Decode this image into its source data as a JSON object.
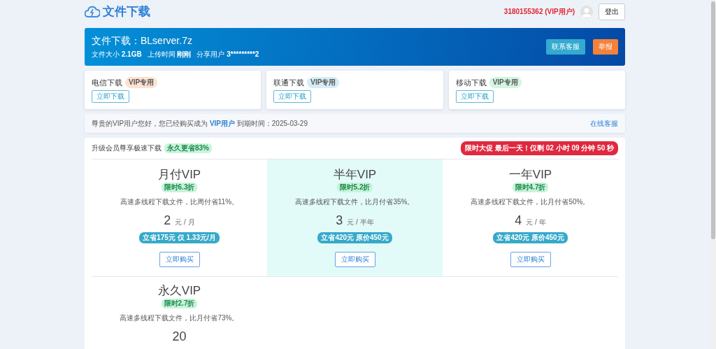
{
  "header": {
    "logo_text": "文件下载",
    "user": "3180155362 (VIP用户)",
    "logout": "登出"
  },
  "banner": {
    "title": "文件下载：BLserver.7z",
    "meta": [
      {
        "label": "文件大小",
        "value": "2.1GB"
      },
      {
        "label": "上传时间",
        "value": "刚刚"
      },
      {
        "label": "分享用户",
        "value": "3*********2"
      }
    ],
    "buttons": [
      {
        "label": "联系客服",
        "kind": "info"
      },
      {
        "label": "举报",
        "kind": "warning"
      }
    ]
  },
  "download_lines": [
    {
      "name": "电信下载",
      "badge": "VIP专用",
      "color": "#fde2d3",
      "button": "立即下载"
    },
    {
      "name": "联通下载",
      "badge": "VIP专用",
      "color": "#d7edf5",
      "button": "立即下载"
    },
    {
      "name": "移动下载",
      "badge": "VIP专用",
      "color": "#d3f5e1",
      "button": "立即下载"
    }
  ],
  "notice": {
    "text": "尊贵的VIP用户您好，您已经购买成为 **VIP用户** 到期时间：2025-03-29",
    "link": "在线客服"
  },
  "pricing": {
    "title": "升级会员尊享极速下载",
    "title_badge": "永久更省83%",
    "countdown": "限时大促 最后一天！仅剩 02 小时 09 分钟 50 秒",
    "plans": [
      {
        "name": "月付VIP",
        "discount": "限时6.3折",
        "desc": "高速多线程下载文件，比周付省11%。",
        "price": "2",
        "unit": "元 / 月",
        "savings": "立省175元 仅 1.33元/月",
        "button": "立即购买",
        "selected": false
      },
      {
        "name": "半年VIP",
        "discount": "限时5.2折",
        "desc": "高速多线程下载文件，比月付省35%。",
        "price": "3",
        "unit": "元 / 半年",
        "savings": "立省420元 原价450元",
        "button": "立即购买",
        "selected": true
      },
      {
        "name": "一年VIP",
        "discount": "限时4.7折",
        "desc": "高速多线程下载文件，比月付省50%。",
        "price": "4",
        "unit": "元 / 年",
        "savings": "立省420元 原价450元",
        "button": "立即购买",
        "selected": false
      },
      {
        "name": "永久VIP",
        "discount": "限时2.7折",
        "desc": "高速多线程下载文件，比月付省73%。",
        "price": "20",
        "selected": false
      }
    ]
  }
}
